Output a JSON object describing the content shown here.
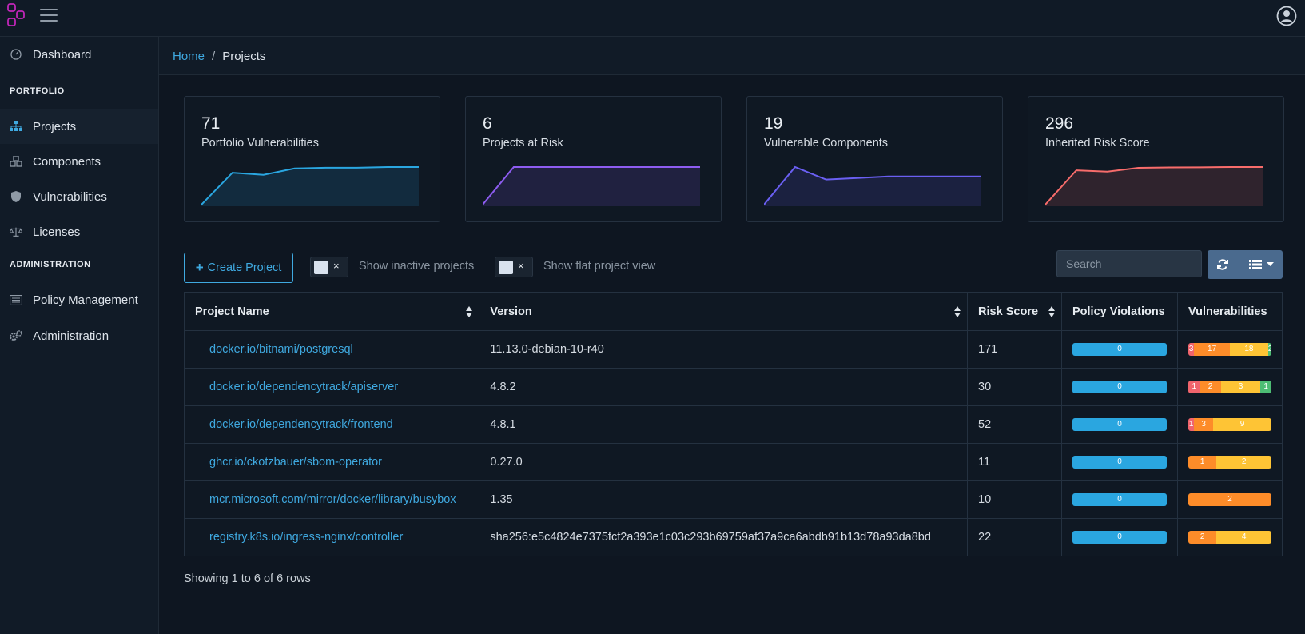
{
  "header": {
    "logo_icon": "dependency-track-logo-icon",
    "menu_icon": "hamburger-menu-icon",
    "user_icon": "user-avatar-icon"
  },
  "sidebar": {
    "dashboard": "Dashboard",
    "portfolio_section": "PORTFOLIO",
    "projects": "Projects",
    "components": "Components",
    "vulnerabilities": "Vulnerabilities",
    "licenses": "Licenses",
    "administration_section": "ADMINISTRATION",
    "policy_management": "Policy Management",
    "administration": "Administration"
  },
  "breadcrumb": {
    "home": "Home",
    "separator": "/",
    "current": "Projects"
  },
  "cards": [
    {
      "value": "71",
      "title": "Portfolio Vulnerabilities",
      "color": "#2aa6e0",
      "trend": [
        0,
        45,
        42,
        51,
        52,
        52,
        53,
        53
      ]
    },
    {
      "value": "6",
      "title": "Projects at Risk",
      "color": "#8d5cf0",
      "trend": [
        0,
        6,
        6,
        6,
        6,
        6,
        6,
        6
      ]
    },
    {
      "value": "19",
      "title": "Vulnerable Components",
      "color": "#6a5ff2",
      "trend": [
        0,
        24,
        16,
        17,
        18,
        18,
        18,
        18
      ]
    },
    {
      "value": "296",
      "title": "Inherited Risk Score",
      "color": "#f86c6b",
      "trend": [
        0,
        270,
        260,
        290,
        293,
        294,
        296,
        296
      ]
    }
  ],
  "toolbar": {
    "create_project": "Create Project",
    "toggle_x": "×",
    "show_inactive": "Show inactive projects",
    "show_flat": "Show flat project view",
    "search_placeholder": "Search"
  },
  "table": {
    "columns": [
      "Project Name",
      "Version",
      "Risk Score",
      "Policy Violations",
      "Vulnerabilities"
    ],
    "rows": [
      {
        "name": "docker.io/bitnami/postgresql",
        "version": "11.13.0-debian-10-r40",
        "risk": "171",
        "policy": "0",
        "vulns": [
          {
            "level": "c",
            "label": "3",
            "w": 7
          },
          {
            "level": "h",
            "label": "17",
            "w": 43
          },
          {
            "level": "m",
            "label": "18",
            "w": 46
          },
          {
            "level": "l",
            "label": "2",
            "w": 4
          }
        ]
      },
      {
        "name": "docker.io/dependencytrack/apiserver",
        "version": "4.8.2",
        "risk": "30",
        "policy": "0",
        "vulns": [
          {
            "level": "c",
            "label": "1",
            "w": 14
          },
          {
            "level": "h",
            "label": "2",
            "w": 25
          },
          {
            "level": "m",
            "label": "3",
            "w": 48
          },
          {
            "level": "l",
            "label": "1",
            "w": 13
          }
        ]
      },
      {
        "name": "docker.io/dependencytrack/frontend",
        "version": "4.8.1",
        "risk": "52",
        "policy": "0",
        "vulns": [
          {
            "level": "c",
            "label": "1",
            "w": 7
          },
          {
            "level": "h",
            "label": "3",
            "w": 23
          },
          {
            "level": "m",
            "label": "9",
            "w": 70
          }
        ]
      },
      {
        "name": "ghcr.io/ckotzbauer/sbom-operator",
        "version": "0.27.0",
        "risk": "11",
        "policy": "0",
        "vulns": [
          {
            "level": "h",
            "label": "1",
            "w": 34
          },
          {
            "level": "m",
            "label": "2",
            "w": 66
          }
        ]
      },
      {
        "name": "mcr.microsoft.com/mirror/docker/library/busybox",
        "version": "1.35",
        "risk": "10",
        "policy": "0",
        "vulns": [
          {
            "level": "h",
            "label": "2",
            "w": 100
          }
        ]
      },
      {
        "name": "registry.k8s.io/ingress-nginx/controller",
        "version": "sha256:e5c4824e7375fcf2a393e1c03c293b69759af37a9ca6abdb91b13d78a93da8bd",
        "risk": "22",
        "policy": "0",
        "vulns": [
          {
            "level": "h",
            "label": "2",
            "w": 34
          },
          {
            "level": "m",
            "label": "4",
            "w": 66
          }
        ]
      }
    ]
  },
  "footer": {
    "pagination": "Showing 1 to 6 of 6 rows"
  }
}
